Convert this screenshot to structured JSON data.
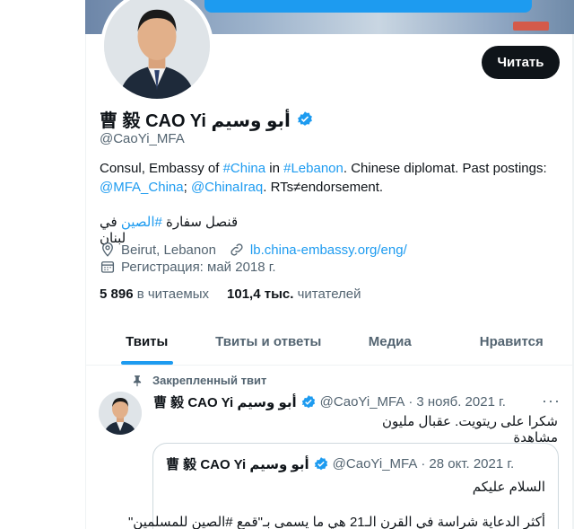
{
  "profile": {
    "display_name": "曹 毅 CAO Yi أبو وسيم",
    "handle": "@CaoYi_MFA",
    "read_button": "Читать",
    "bio": {
      "p1": "Consul, Embassy of ",
      "h1": "#China",
      "p2": " in ",
      "h2": "#Lebanon",
      "p3": ". Chinese diplomat. Past postings: ",
      "m1": "@MFA_China",
      "p4": "; ",
      "m2": "@ChinaIraq",
      "p5": ". RTs≠endorsement."
    },
    "bio_arabic": {
      "before": "قنصل سفارة ",
      "hashtag": "#الصين",
      "after": " في لبنان"
    },
    "location": "Beirut, Lebanon",
    "website": "lb.china-embassy.org/eng/",
    "joined": "Регистрация: май 2018 г.",
    "following_count": "5 896",
    "following_label": "в читаемых",
    "followers_count": "101,4 тыс.",
    "followers_label": "читателей"
  },
  "tabs": [
    {
      "label": "Твиты",
      "active": true
    },
    {
      "label": "Твиты и ответы",
      "active": false
    },
    {
      "label": "Медиа",
      "active": false
    },
    {
      "label": "Нравится",
      "active": false
    }
  ],
  "pinned_tweet": {
    "pinned_label": "Закрепленный твит",
    "author": "曹 毅 CAO Yi أبو وسيم",
    "handle": "@CaoYi_MFA",
    "separator": "·",
    "date": "3 нояб. 2021 г.",
    "more": "···",
    "text": "شكرا على ريتويت. عقبال مليون مشاهدة",
    "quote": {
      "author": "曹 毅 CAO Yi أبو وسيم",
      "handle": "@CaoYi_MFA",
      "separator": "·",
      "date": "28 окт. 2021 г.",
      "line1": "السلام عليكم",
      "line2": "أكثر الدعاية شراسة في القرن الـ21 هي ما يسمى بـ\"قمع #الصين للمسلمين\""
    }
  },
  "colors": {
    "accent": "#1d9bf0",
    "text": "#0f1419",
    "secondary": "#536471"
  }
}
